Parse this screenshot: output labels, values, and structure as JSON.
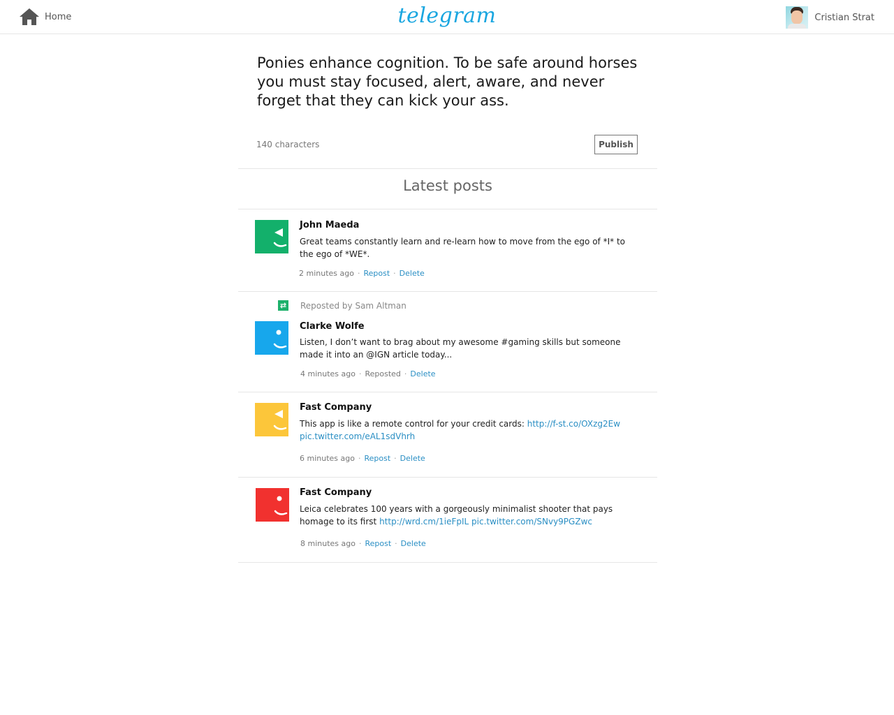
{
  "header": {
    "home_label": "Home",
    "logo_text": "telegram",
    "user_name": "Cristian Strat"
  },
  "compose": {
    "text": "Ponies enhance cognition. To be safe around horses you must stay focused, alert, aware, and never forget that they can kick your ass.",
    "char_count": "140 characters",
    "publish_label": "Publish"
  },
  "feed": {
    "heading": "Latest posts",
    "posts": [
      {
        "author": "John Maeda",
        "avatar_color": "#13b06b",
        "text": "Great teams constantly learn and re-learn how to move from the ego of *I* to the ego of *WE*.",
        "time": "2 minutes ago",
        "repost_label": "Repost",
        "delete_label": "Delete"
      },
      {
        "reposted_by": "Reposted by Sam Altman",
        "author": "Clarke Wolfe",
        "avatar_color": "#17a7ec",
        "text": "Listen, I don’t want to brag about my awesome #gaming skills but someone made it into an @IGN article today...",
        "time": "4 minutes ago",
        "repost_label": "Reposted",
        "delete_label": "Delete"
      },
      {
        "author": "Fast Company",
        "avatar_color": "#fcc63a",
        "text": "This app is like a remote control for your credit cards:",
        "link1": "http://f-st.co/OXzg2Ew",
        "link2": "pic.twitter.com/eAL1sdVhrh",
        "time": "6 minutes ago",
        "repost_label": "Repost",
        "delete_label": "Delete"
      },
      {
        "author": "Fast Company",
        "avatar_color": "#f1312f",
        "text": "Leica celebrates 100 years with a gorgeously minimalist shooter that pays homage to its first",
        "link1": "http://wrd.cm/1ieFpIL",
        "link2": "pic.twitter.com/SNvy9PGZwc",
        "time": "8 minutes ago",
        "repost_label": "Repost",
        "delete_label": "Delete"
      }
    ]
  },
  "colors": {
    "accent": "#19a6e0",
    "link": "#2b8fc4",
    "repost_badge": "#1db16b"
  }
}
